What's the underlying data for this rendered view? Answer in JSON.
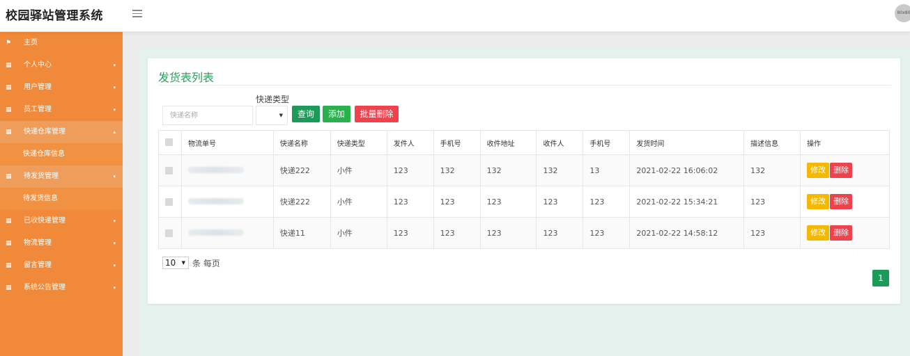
{
  "header": {
    "brand": "校园驿站管理系统",
    "avatar_text": "80x80"
  },
  "sidebar": {
    "items": [
      {
        "label": "主页",
        "icon": "flag-icon",
        "caret": false
      },
      {
        "label": "个人中心",
        "icon": "grid-icon",
        "caret": true
      },
      {
        "label": "用户管理",
        "icon": "grid-icon",
        "caret": true
      },
      {
        "label": "员工管理",
        "icon": "grid-icon",
        "caret": true
      },
      {
        "label": "快递仓库管理",
        "icon": "grid-icon",
        "caret": true,
        "expanded": true,
        "sub": "快递仓库信息"
      },
      {
        "label": "待发货管理",
        "icon": "grid-icon",
        "caret": true,
        "expanded": true,
        "sub": "待发货信息"
      },
      {
        "label": "已收快递管理",
        "icon": "grid-icon",
        "caret": true
      },
      {
        "label": "物流管理",
        "icon": "grid-icon",
        "caret": true
      },
      {
        "label": "留言管理",
        "icon": "grid-icon",
        "caret": true
      },
      {
        "label": "系统公告管理",
        "icon": "grid-icon",
        "caret": true
      }
    ]
  },
  "main": {
    "title": "发货表列表",
    "search": {
      "name_placeholder": "快递名称",
      "type_label": "快递类型",
      "type_value": "",
      "query_label": "查询",
      "add_label": "添加",
      "bulk_delete_label": "批量删除"
    },
    "table": {
      "headers": [
        "物流单号",
        "快递名称",
        "快递类型",
        "发件人",
        "手机号",
        "收件地址",
        "收件人",
        "手机号",
        "发货时间",
        "描述信息",
        "操作"
      ],
      "rows": [
        {
          "name": "快递222",
          "type": "小件",
          "sender": "123",
          "sender_phone": "132",
          "address": "132",
          "receiver": "132",
          "receiver_phone": "13",
          "time": "2021-02-22 16:06:02",
          "desc": "132"
        },
        {
          "name": "快递222",
          "type": "小件",
          "sender": "123",
          "sender_phone": "123",
          "address": "123",
          "receiver": "123",
          "receiver_phone": "123",
          "time": "2021-02-22 15:34:21",
          "desc": "123"
        },
        {
          "name": "快递11",
          "type": "小件",
          "sender": "123",
          "sender_phone": "123",
          "address": "123",
          "receiver": "123",
          "receiver_phone": "123",
          "time": "2021-02-22 14:58:12",
          "desc": "123"
        }
      ],
      "edit_label": "修改",
      "delete_label": "删除"
    },
    "pagination": {
      "page_size": "10",
      "page_size_suffix": "条 每页",
      "current_page": "1"
    }
  },
  "colors": {
    "sidebar": "#f0893a",
    "primary_green": "#1b9a59",
    "danger_red": "#f0424d",
    "warning_yellow": "#f5b800"
  }
}
